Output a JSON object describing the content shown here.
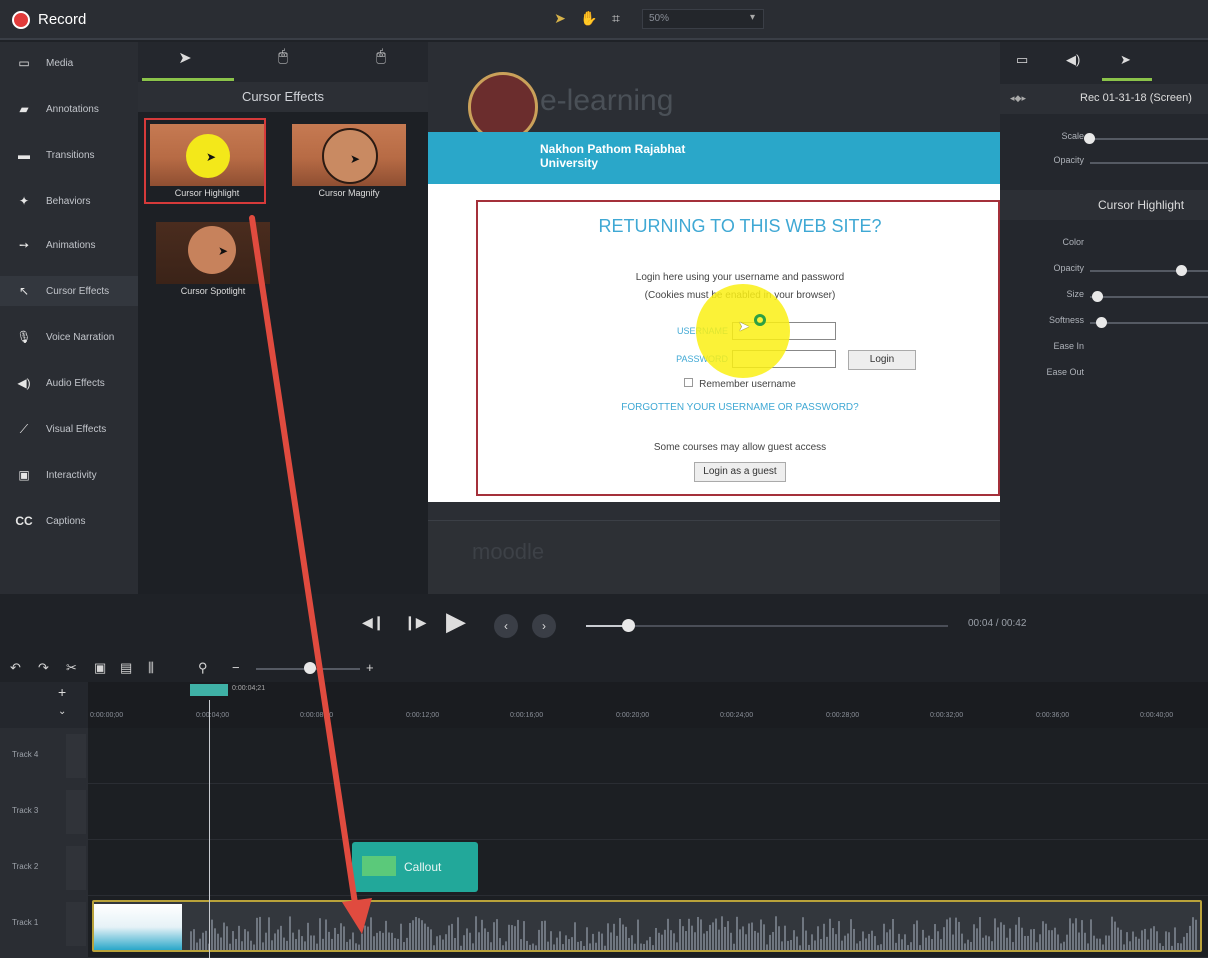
{
  "topbar": {
    "record_label": "Record",
    "zoom": "50%"
  },
  "sidebar": {
    "items": [
      {
        "label": "Media",
        "icon": "media-icon"
      },
      {
        "label": "Annotations",
        "icon": "annotations-icon"
      },
      {
        "label": "Transitions",
        "icon": "transitions-icon"
      },
      {
        "label": "Behaviors",
        "icon": "behaviors-icon"
      },
      {
        "label": "Animations",
        "icon": "animations-icon"
      },
      {
        "label": "Cursor Effects",
        "icon": "cursor-effects-icon"
      },
      {
        "label": "Voice Narration",
        "icon": "microphone-icon"
      },
      {
        "label": "Audio Effects",
        "icon": "speaker-icon"
      },
      {
        "label": "Visual Effects",
        "icon": "wand-icon"
      },
      {
        "label": "Interactivity",
        "icon": "interactivity-icon"
      },
      {
        "label": "Captions",
        "icon": "captions-icon"
      }
    ]
  },
  "effects_panel": {
    "title": "Cursor Effects",
    "thumbnails": [
      {
        "label": "Cursor Highlight"
      },
      {
        "label": "Cursor Magnify"
      },
      {
        "label": "Cursor Spotlight"
      }
    ]
  },
  "canvas": {
    "site_title": "e-learning",
    "university": "Nakhon Pathom Rajabhat University",
    "login_heading": "RETURNING TO THIS WEB SITE?",
    "login_hint": "Login here using your username and password",
    "cookies_hint": "(Cookies must be enabled in your browser)",
    "username_label": "USERNAME",
    "password_label": "PASSWORD",
    "login_button": "Login",
    "remember": "Remember username",
    "forgot_link": "FORGOTTEN YOUR USERNAME OR PASSWORD?",
    "guest_hint": "Some courses may allow guest access",
    "guest_button": "Login as a guest",
    "footer_logo": "moodle"
  },
  "properties": {
    "media_name": "Rec 01-31-18 (Screen)",
    "rows_top": [
      {
        "label": "Scale",
        "value": 0.0
      },
      {
        "label": "Opacity",
        "value": 1.0
      }
    ],
    "section_title": "Cursor Highlight",
    "rows": [
      {
        "label": "Color"
      },
      {
        "label": "Opacity",
        "value": 0.85
      },
      {
        "label": "Size",
        "value": 0.1
      },
      {
        "label": "Softness",
        "value": 0.1
      },
      {
        "label": "Ease In"
      },
      {
        "label": "Ease Out"
      }
    ]
  },
  "playback": {
    "time": "00:04  /  00:42",
    "progress": 0.1
  },
  "timeline": {
    "playhead_time": "0:00:04;21",
    "ticks": [
      "0:00:00;00",
      "0:00:04;00",
      "0:00:08;00",
      "0:00:12;00",
      "0:00:16;00",
      "0:00:20;00",
      "0:00:24;00",
      "0:00:28;00",
      "0:00:32;00",
      "0:00:36;00",
      "0:00:40;00"
    ],
    "tracks": [
      "Track 4",
      "Track 3",
      "Track 2",
      "Track 1"
    ],
    "callout_label": "Callout"
  }
}
